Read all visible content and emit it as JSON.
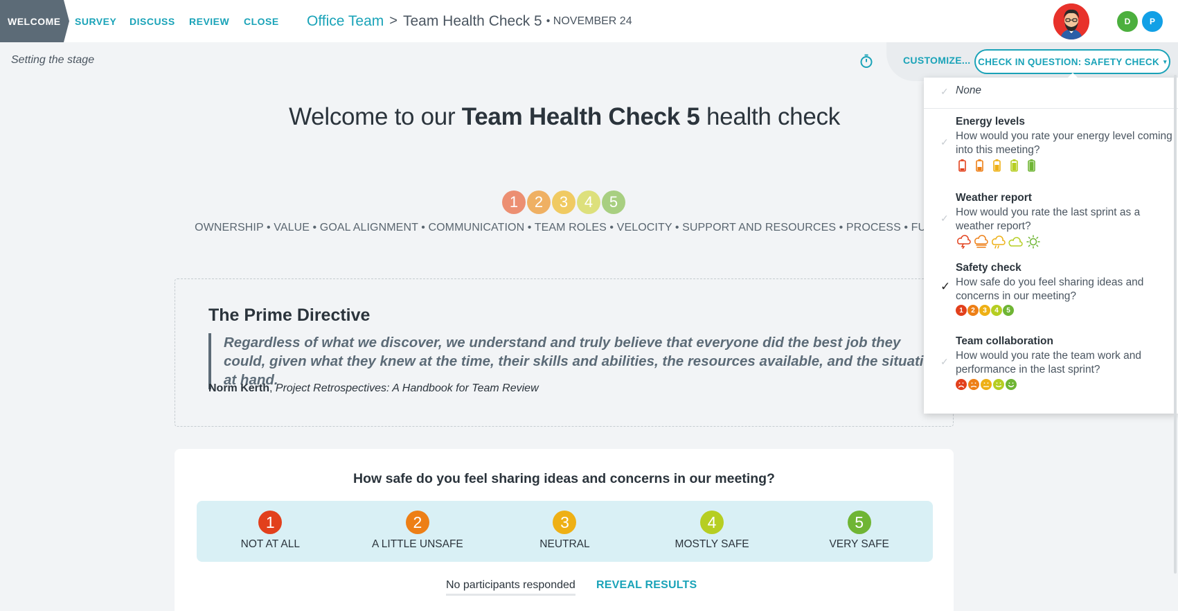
{
  "steps": [
    "WELCOME",
    "SURVEY",
    "DISCUSS",
    "REVIEW",
    "CLOSE"
  ],
  "breadcrumb": {
    "team": "Office Team",
    "separator": ">",
    "meeting": "Team Health Check 5",
    "date": "• NOVEMBER 24"
  },
  "participants": [
    "D",
    "P"
  ],
  "participant_colors": [
    "#4caf3e",
    "#12a0e6"
  ],
  "subbar": {
    "stage": "Setting the stage",
    "customize": "CUSTOMIZE...",
    "check_in_label": "CHECK IN QUESTION:  SAFETY CHECK",
    "caret": "▾"
  },
  "dropdown": {
    "none": "None",
    "options": [
      {
        "name": "Energy levels",
        "desc": "How would you rate your energy level coming into this meeting?",
        "icons": "battery-icons"
      },
      {
        "name": "Weather report",
        "desc": "How would you rate the last sprint as a weather report?",
        "icons": "weather-icons"
      },
      {
        "name": "Safety check",
        "desc": "How safe do you feel sharing ideas and concerns in our meeting?",
        "icons": "number-icons",
        "selected": true
      },
      {
        "name": "Team collaboration",
        "desc": "How would you rate the team work and performance in the last sprint?",
        "icons": "face-icons"
      }
    ],
    "mini_numbers": [
      "1",
      "2",
      "3",
      "4",
      "5"
    ]
  },
  "welcome": {
    "prefix": "Welcome to our ",
    "name": "Team Health Check 5",
    "suffix": " health check"
  },
  "scale": [
    "1",
    "2",
    "3",
    "4",
    "5"
  ],
  "scale_colors": [
    "#ec8f72",
    "#efb063",
    "#f0ca62",
    "#dde07c",
    "#a8cf81"
  ],
  "topics": "OWNERSHIP • VALUE • GOAL ALIGNMENT • COMMUNICATION • TEAM ROLES • VELOCITY • SUPPORT AND RESOURCES • PROCESS • FUN",
  "prime": {
    "title": "The Prime Directive",
    "quote": "Regardless of what we discover, we understand and truly believe that everyone did the best job they could, given what they knew at the time, their skills and abilities, the resources available, and the situation at hand.",
    "author": "Norm Kerth",
    "book": "Project Retrospectives: A Handbook for Team Review"
  },
  "question": {
    "title": "How safe do you feel sharing ideas and concerns in our meeting?",
    "answers": [
      {
        "num": "1",
        "label": "NOT AT ALL"
      },
      {
        "num": "2",
        "label": "A LITTLE UNSAFE"
      },
      {
        "num": "3",
        "label": "NEUTRAL"
      },
      {
        "num": "4",
        "label": "MOSTLY SAFE"
      },
      {
        "num": "5",
        "label": "VERY SAFE"
      }
    ],
    "answer_colors": [
      "#e2401c",
      "#ed7f16",
      "#eeb015",
      "#b6ce22",
      "#6fb534"
    ],
    "no_response": "No participants responded",
    "reveal": "REVEAL RESULTS"
  },
  "colors": {
    "accent": "#1aa3b8",
    "welcome_tab": "#5c6b77"
  }
}
